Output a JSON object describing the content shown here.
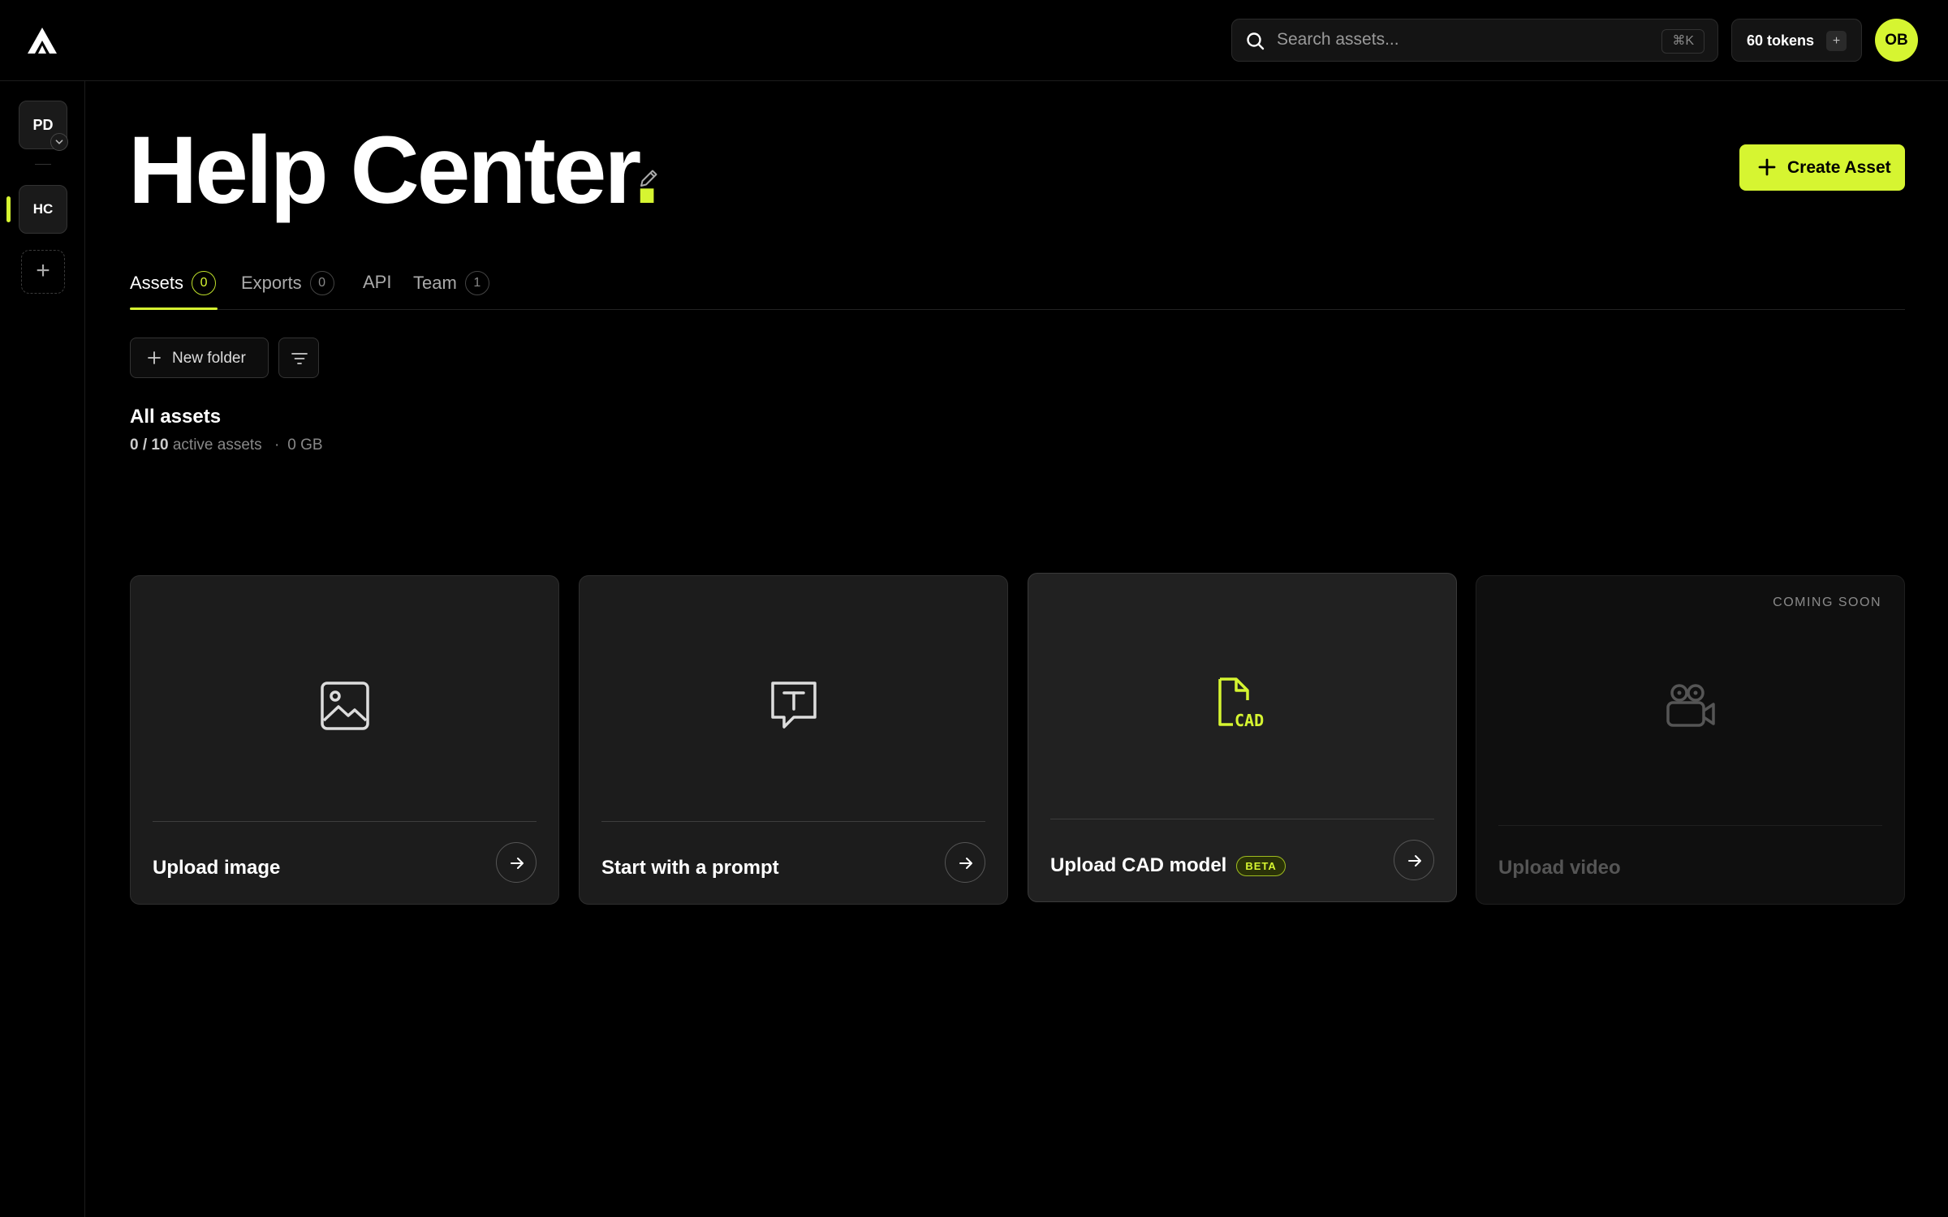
{
  "colors": {
    "accent": "#d6f531",
    "background": "#000000",
    "card": "#1c1c1c"
  },
  "topbar": {
    "logo_icon": "triangle-logo-icon",
    "search": {
      "placeholder": "Search assets...",
      "shortcut": "⌘K",
      "icon": "search-icon"
    },
    "tokens": {
      "label": "60 tokens",
      "plus": "+"
    },
    "avatar": "OB"
  },
  "sidebar": {
    "workspaces": [
      {
        "initials": "PD",
        "active": false
      },
      {
        "initials": "HC",
        "active": true
      }
    ],
    "add_label": "+"
  },
  "header": {
    "title": "Help Center",
    "title_dot": ".",
    "edit_icon": "pencil-icon",
    "create_button": "Create Asset"
  },
  "tabs": [
    {
      "label": "Assets",
      "count": "0",
      "active": true
    },
    {
      "label": "Exports",
      "count": "0",
      "active": false
    },
    {
      "label": "API",
      "count": null,
      "active": false
    },
    {
      "label": "Team",
      "count": "1",
      "active": false
    }
  ],
  "toolbar": {
    "new_folder": "New folder",
    "filter_icon": "filter-icon"
  },
  "section": {
    "title": "All assets",
    "active_count": "0",
    "slash": "/",
    "limit": "10",
    "active_label": "active assets",
    "separator": "·",
    "size": "0 GB"
  },
  "cards": [
    {
      "label": "Upload image",
      "icon": "image-icon"
    },
    {
      "label": "Start with a prompt",
      "icon": "text-prompt-icon"
    },
    {
      "label": "Upload CAD model",
      "icon": "cad-file-icon",
      "badge": "BETA",
      "icon_text": "CAD"
    },
    {
      "label": "Upload video",
      "icon": "video-camera-icon",
      "tag": "COMING SOON",
      "disabled": true
    }
  ]
}
